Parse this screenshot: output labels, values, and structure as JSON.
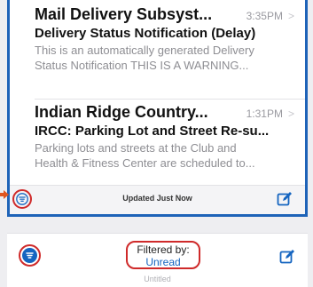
{
  "messages": [
    {
      "sender": "Mail Delivery Subsyst...",
      "time": "3:35PM",
      "chevron": ">",
      "subject": "Delivery Status Notification (Delay)",
      "preview_line1": "This is an automatically generated Delivery",
      "preview_line2": "Status Notification THIS IS A WARNING..."
    },
    {
      "sender": "Indian Ridge Country...",
      "time": "1:31PM",
      "chevron": ">",
      "subject": "IRCC: Parking Lot and Street Re-su...",
      "preview_line1": "Parking lots and streets at the Club and",
      "preview_line2": "Health & Fitness Center are scheduled to..."
    }
  ],
  "toolbar": {
    "status": "Updated Just Now",
    "filter_icon": "filter-circle-icon",
    "compose_icon": "compose-icon"
  },
  "filtered_toolbar": {
    "filtered_label": "Filtered by:",
    "filter_name": "Unread",
    "subtitle": "Untitled",
    "filter_icon": "filter-active-icon",
    "compose_icon": "compose-icon"
  },
  "colors": {
    "accent": "#1565c0",
    "highlight": "#cf2a2a",
    "panel_border": "#1e63b8"
  }
}
